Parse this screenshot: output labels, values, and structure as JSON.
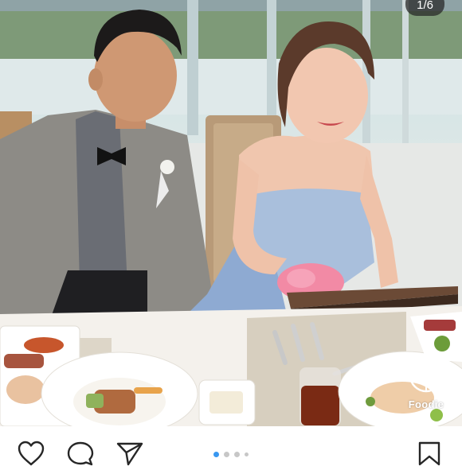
{
  "post": {
    "slide_counter": "1/6",
    "current_slide": 1,
    "total_slides": 6,
    "watermark": "Foodie"
  },
  "icons": {
    "like": "heart-outline",
    "comment": "speech-bubble-outline",
    "share": "paper-plane-outline",
    "save": "bookmark-outline",
    "watermark": "camera-lens-logo"
  },
  "colors": {
    "active_dot": "#3897f0",
    "inactive_dot": "#c7c7c7",
    "icon_stroke": "#262626"
  }
}
